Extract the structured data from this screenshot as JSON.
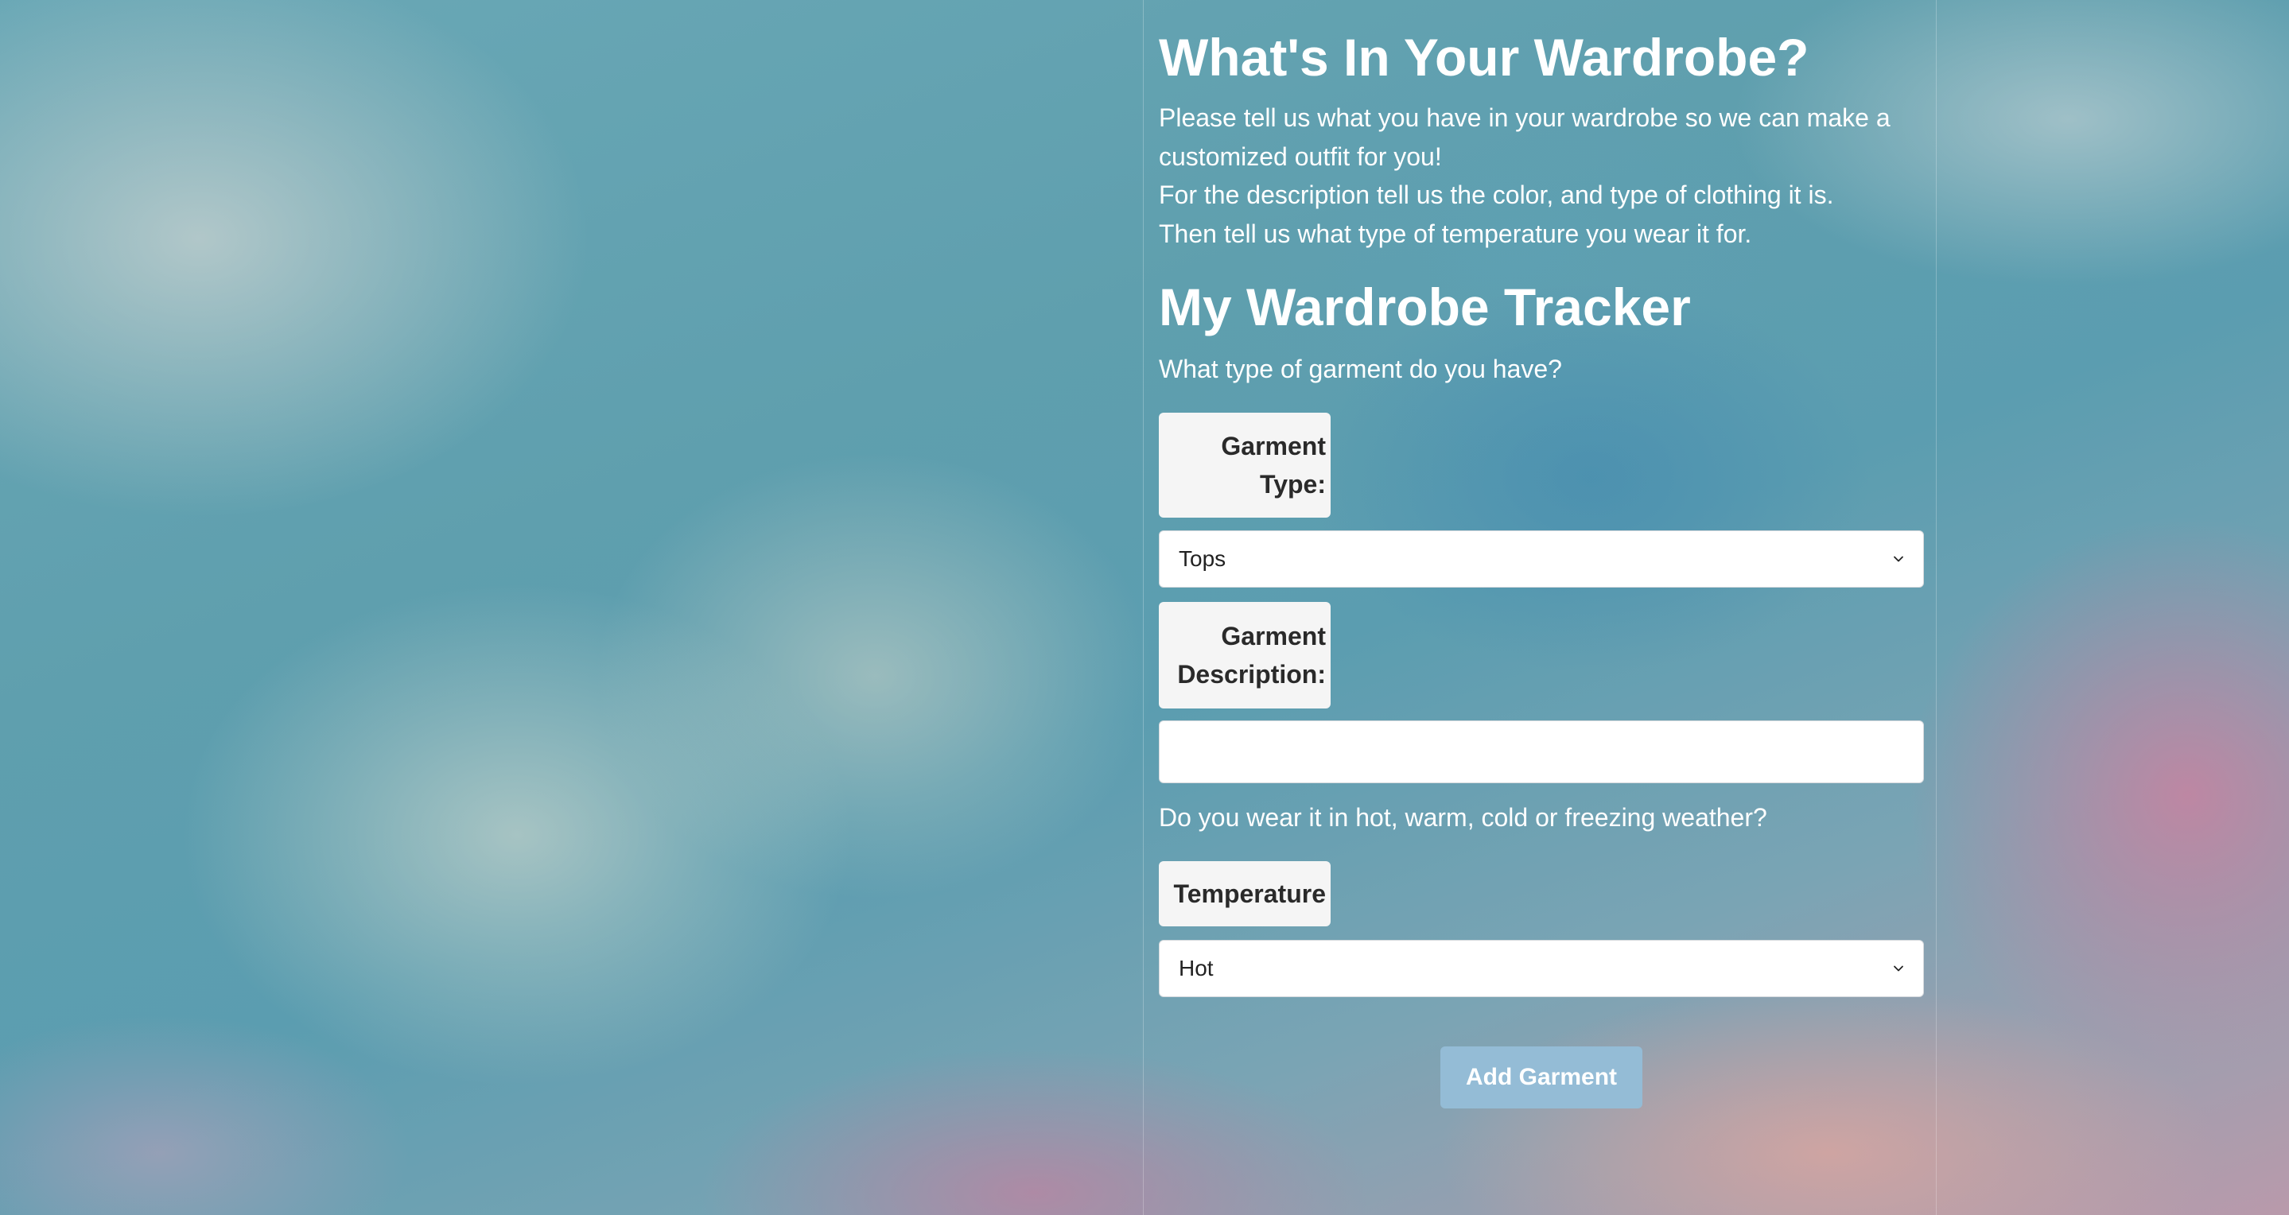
{
  "header": {
    "title": "What's In Your Wardrobe?",
    "intro_lines": [
      "Please tell us what you have in your wardrobe so we can make a customized outfit for you!",
      "For the description tell us the color, and type of clothing it is.",
      "Then tell us what type of temperature you wear it for."
    ]
  },
  "tracker": {
    "title": "My Wardrobe Tracker",
    "garment_question": "What type of garment do you have?",
    "garment_type_label": "Garment Type:",
    "garment_type_value": "Tops",
    "garment_description_label": "Garment Description:",
    "garment_description_value": "",
    "temperature_question": "Do you wear it in hot, warm, cold or freezing weather?",
    "temperature_label": "Temperature",
    "temperature_value": "Hot",
    "add_button_label": "Add Garment"
  }
}
